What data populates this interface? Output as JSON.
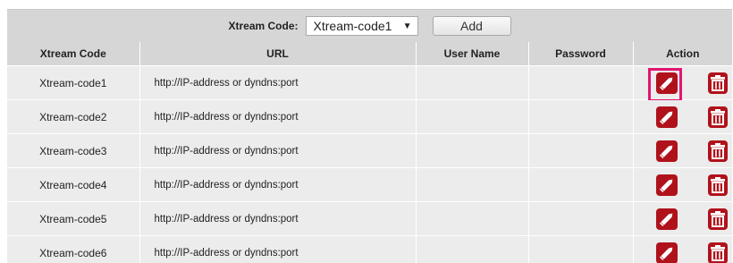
{
  "toolbar": {
    "label": "Xtream Code:",
    "selected": "Xtream-code1",
    "add_label": "Add"
  },
  "table": {
    "headers": {
      "code": "Xtream Code",
      "url": "URL",
      "user": "User Name",
      "password": "Password",
      "action": "Action"
    },
    "rows": [
      {
        "code": "Xtream-code1",
        "url": "http://IP-address or dyndns:port",
        "user": "",
        "password": ""
      },
      {
        "code": "Xtream-code2",
        "url": "http://IP-address or dyndns:port",
        "user": "",
        "password": ""
      },
      {
        "code": "Xtream-code3",
        "url": "http://IP-address or dyndns:port",
        "user": "",
        "password": ""
      },
      {
        "code": "Xtream-code4",
        "url": "http://IP-address or dyndns:port",
        "user": "",
        "password": ""
      },
      {
        "code": "Xtream-code5",
        "url": "http://IP-address or dyndns:port",
        "user": "",
        "password": ""
      },
      {
        "code": "Xtream-code6",
        "url": "http://IP-address or dyndns:port",
        "user": "",
        "password": ""
      }
    ]
  },
  "icons": {
    "edit": "pencil-icon",
    "delete": "trash-icon"
  },
  "colors": {
    "icon_red": "#b0121b",
    "highlight": "#e01670",
    "header_bg": "#d6d6d6",
    "row_bg": "#ececec"
  }
}
